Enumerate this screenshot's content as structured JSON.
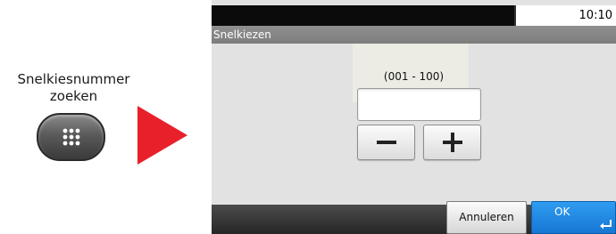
{
  "instruction": {
    "label_line1": "Snelkiesnummer",
    "label_line2": "zoeken"
  },
  "icons": {
    "hardware_key": "keypad-dots-icon",
    "arrow": "arrow-right-icon",
    "minus": "minus-icon",
    "plus": "plus-icon",
    "enter": "enter-return-icon"
  },
  "colors": {
    "arrow_red": "#e8202a",
    "ok_blue": "#1e88e5",
    "title_bar": "#858585"
  },
  "screen": {
    "status": {
      "time": "10:10"
    },
    "title": "Snelkiezen",
    "range_label": "(001 - 100)",
    "input_value": "",
    "buttons": {
      "cancel": "Annuleren",
      "ok": "OK"
    }
  }
}
